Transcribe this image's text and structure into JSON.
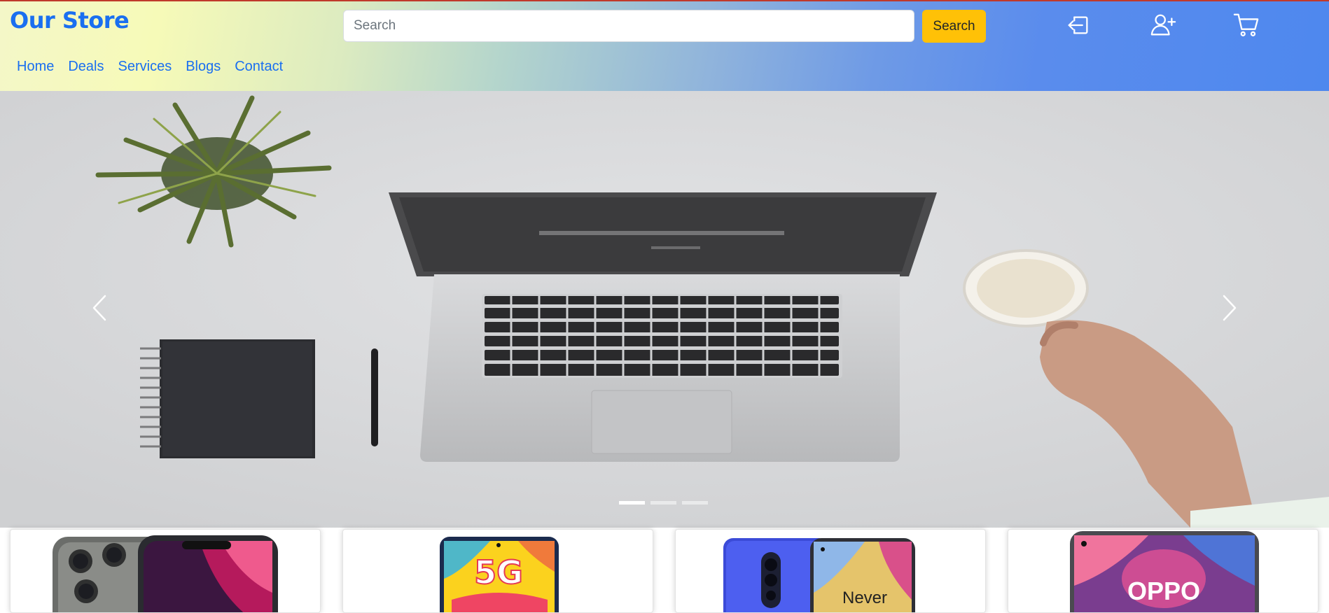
{
  "brand": "Our Store",
  "search": {
    "placeholder": "Search",
    "value": "",
    "button_label": "Search"
  },
  "header_icons": [
    "login-icon",
    "add-user-icon",
    "cart-icon"
  ],
  "nav": [
    "Home",
    "Deals",
    "Services",
    "Blogs",
    "Contact"
  ],
  "carousel": {
    "slide_count": 3,
    "active_index": 0,
    "slide_subject": "laptop-desk-flatlay",
    "prev_icon": "chevron-left-icon",
    "next_icon": "chevron-right-icon"
  },
  "products": [
    {
      "image": "iphone-13-pro-phone-image"
    },
    {
      "image": "samsung-5g-phone-image",
      "label": "5G"
    },
    {
      "image": "oneplus-8-pro-phone-image",
      "label": "Never"
    },
    {
      "image": "oppo-phone-image",
      "label": "OPPO"
    }
  ],
  "colors": {
    "brand": "#1a6ff0",
    "search_button": "#ffc107",
    "nav_link": "#1a6ff0",
    "header_gradient_end": "#4e88ee"
  }
}
